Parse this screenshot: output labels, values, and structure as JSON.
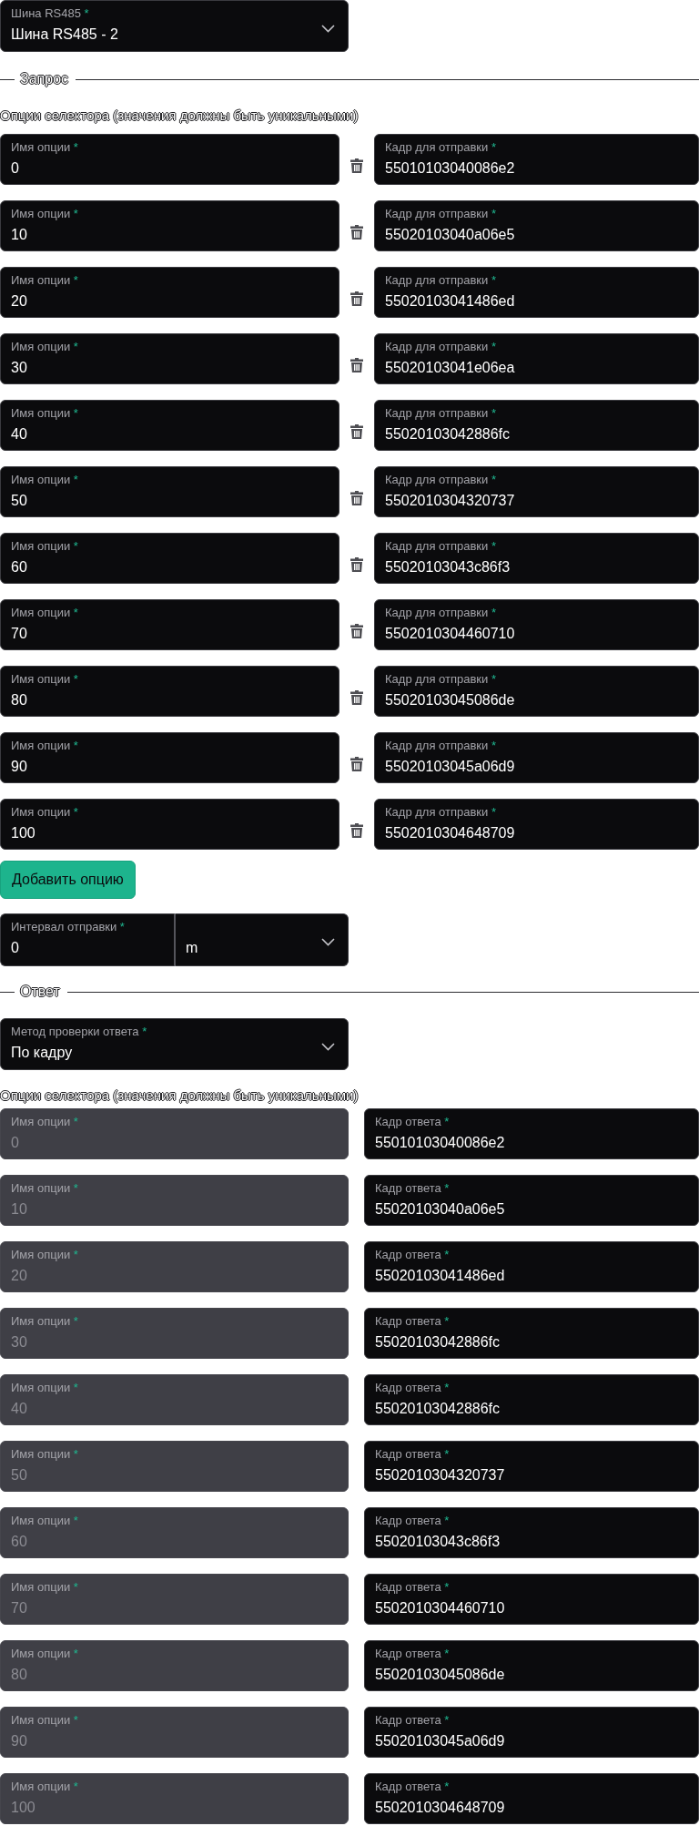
{
  "bus_select": {
    "label": "Шина RS485",
    "required_mark": "*",
    "value": "Шина RS485 - 2"
  },
  "request": {
    "legend": "Запрос",
    "options_caption": "Опции селектора (значения должны быть уникальными)",
    "options": [
      {
        "name": {
          "label": "Имя опции",
          "required_mark": "*",
          "value": "0",
          "disabled": false
        },
        "frame": {
          "label": "Кадр для отправки",
          "required_mark": "*",
          "value": "55010103040086e2",
          "disabled": false
        }
      },
      {
        "name": {
          "label": "Имя опции",
          "required_mark": "*",
          "value": "10",
          "disabled": false
        },
        "frame": {
          "label": "Кадр для отправки",
          "required_mark": "*",
          "value": "55020103040a06e5",
          "disabled": false
        }
      },
      {
        "name": {
          "label": "Имя опции",
          "required_mark": "*",
          "value": "20",
          "disabled": false
        },
        "frame": {
          "label": "Кадр для отправки",
          "required_mark": "*",
          "value": "55020103041486ed",
          "disabled": false
        }
      },
      {
        "name": {
          "label": "Имя опции",
          "required_mark": "*",
          "value": "30",
          "disabled": false
        },
        "frame": {
          "label": "Кадр для отправки",
          "required_mark": "*",
          "value": "55020103041e06ea",
          "disabled": false
        }
      },
      {
        "name": {
          "label": "Имя опции",
          "required_mark": "*",
          "value": "40",
          "disabled": false
        },
        "frame": {
          "label": "Кадр для отправки",
          "required_mark": "*",
          "value": "55020103042886fc",
          "disabled": false
        }
      },
      {
        "name": {
          "label": "Имя опции",
          "required_mark": "*",
          "value": "50",
          "disabled": false
        },
        "frame": {
          "label": "Кадр для отправки",
          "required_mark": "*",
          "value": "5502010304320737",
          "disabled": false
        }
      },
      {
        "name": {
          "label": "Имя опции",
          "required_mark": "*",
          "value": "60",
          "disabled": false
        },
        "frame": {
          "label": "Кадр для отправки",
          "required_mark": "*",
          "value": "55020103043c86f3",
          "disabled": false
        }
      },
      {
        "name": {
          "label": "Имя опции",
          "required_mark": "*",
          "value": "70",
          "disabled": false
        },
        "frame": {
          "label": "Кадр для отправки",
          "required_mark": "*",
          "value": "5502010304460710",
          "disabled": false
        }
      },
      {
        "name": {
          "label": "Имя опции",
          "required_mark": "*",
          "value": "80",
          "disabled": false
        },
        "frame": {
          "label": "Кадр для отправки",
          "required_mark": "*",
          "value": "55020103045086de",
          "disabled": false
        }
      },
      {
        "name": {
          "label": "Имя опции",
          "required_mark": "*",
          "value": "90",
          "disabled": false
        },
        "frame": {
          "label": "Кадр для отправки",
          "required_mark": "*",
          "value": "55020103045a06d9",
          "disabled": false
        }
      },
      {
        "name": {
          "label": "Имя опции",
          "required_mark": "*",
          "value": "100",
          "disabled": false
        },
        "frame": {
          "label": "Кадр для отправки",
          "required_mark": "*",
          "value": "5502010304648709",
          "disabled": false
        }
      }
    ],
    "add_button": "Добавить опцию",
    "interval": {
      "label": "Интервал отправки",
      "required_mark": "*",
      "value": "0",
      "unit": "m"
    }
  },
  "response": {
    "legend": "Ответ",
    "method_select": {
      "label": "Метод проверки ответа",
      "required_mark": "*",
      "value": "По кадру"
    },
    "options_caption": "Опции селектора (значения должны быть уникальными)",
    "options": [
      {
        "name": {
          "label": "Имя опции",
          "required_mark": "*",
          "value": "0",
          "disabled": true
        },
        "frame": {
          "label": "Кадр ответа",
          "required_mark": "*",
          "value": "55010103040086e2",
          "disabled": false
        }
      },
      {
        "name": {
          "label": "Имя опции",
          "required_mark": "*",
          "value": "10",
          "disabled": true
        },
        "frame": {
          "label": "Кадр ответа",
          "required_mark": "*",
          "value": "55020103040a06e5",
          "disabled": false
        }
      },
      {
        "name": {
          "label": "Имя опции",
          "required_mark": "*",
          "value": "20",
          "disabled": true
        },
        "frame": {
          "label": "Кадр ответа",
          "required_mark": "*",
          "value": "55020103041486ed",
          "disabled": false
        }
      },
      {
        "name": {
          "label": "Имя опции",
          "required_mark": "*",
          "value": "30",
          "disabled": true
        },
        "frame": {
          "label": "Кадр ответа",
          "required_mark": "*",
          "value": "55020103042886fc",
          "disabled": false
        }
      },
      {
        "name": {
          "label": "Имя опции",
          "required_mark": "*",
          "value": "40",
          "disabled": true
        },
        "frame": {
          "label": "Кадр ответа",
          "required_mark": "*",
          "value": "55020103042886fc",
          "disabled": false
        }
      },
      {
        "name": {
          "label": "Имя опции",
          "required_mark": "*",
          "value": "50",
          "disabled": true
        },
        "frame": {
          "label": "Кадр ответа",
          "required_mark": "*",
          "value": "5502010304320737",
          "disabled": false
        }
      },
      {
        "name": {
          "label": "Имя опции",
          "required_mark": "*",
          "value": "60",
          "disabled": true
        },
        "frame": {
          "label": "Кадр ответа",
          "required_mark": "*",
          "value": "55020103043c86f3",
          "disabled": false
        }
      },
      {
        "name": {
          "label": "Имя опции",
          "required_mark": "*",
          "value": "70",
          "disabled": true
        },
        "frame": {
          "label": "Кадр ответа",
          "required_mark": "*",
          "value": "5502010304460710",
          "disabled": false
        }
      },
      {
        "name": {
          "label": "Имя опции",
          "required_mark": "*",
          "value": "80",
          "disabled": true
        },
        "frame": {
          "label": "Кадр ответа",
          "required_mark": "*",
          "value": "55020103045086de",
          "disabled": false
        }
      },
      {
        "name": {
          "label": "Имя опции",
          "required_mark": "*",
          "value": "90",
          "disabled": true
        },
        "frame": {
          "label": "Кадр ответа",
          "required_mark": "*",
          "value": "55020103045a06d9",
          "disabled": false
        }
      },
      {
        "name": {
          "label": "Имя опции",
          "required_mark": "*",
          "value": "100",
          "disabled": true
        },
        "frame": {
          "label": "Кадр ответа",
          "required_mark": "*",
          "value": "5502010304648709",
          "disabled": false
        }
      }
    ]
  }
}
